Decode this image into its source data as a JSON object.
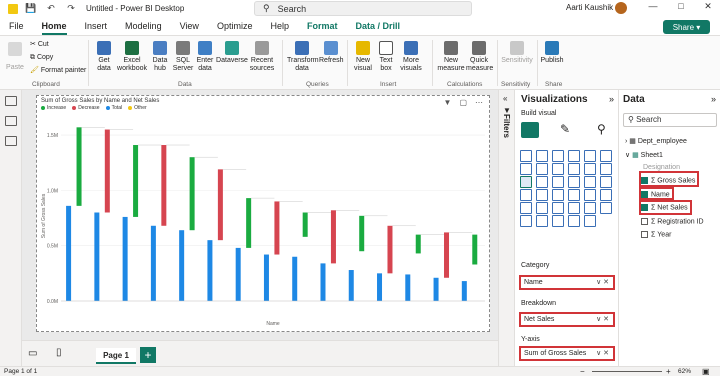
{
  "titlebar": {
    "file_name": "Untitled - Power BI Desktop",
    "search": "Search",
    "user": "Aarti Kaushik"
  },
  "tabs": [
    "File",
    "Home",
    "Insert",
    "Modeling",
    "View",
    "Optimize",
    "Help",
    "Format",
    "Data / Drill"
  ],
  "active_tab": "Home",
  "share_label": "Share",
  "ribbon": {
    "clipboard": {
      "paste": "Paste",
      "cut": "Cut",
      "copy": "Copy",
      "format_painter": "Format painter",
      "group": "Clipboard"
    },
    "data_buttons": [
      {
        "l1": "Get",
        "l2": "data"
      },
      {
        "l1": "Excel",
        "l2": "workbook"
      },
      {
        "l1": "Data",
        "l2": "hub"
      },
      {
        "l1": "SQL",
        "l2": "Server"
      },
      {
        "l1": "Enter",
        "l2": "data"
      },
      {
        "l1": "Dataverse",
        "l2": ""
      },
      {
        "l1": "Recent",
        "l2": "sources"
      }
    ],
    "data_group": "Data",
    "queries": [
      {
        "l1": "Transform",
        "l2": "data"
      },
      {
        "l1": "Refresh",
        "l2": ""
      }
    ],
    "queries_group": "Queries",
    "insert": [
      {
        "l1": "New",
        "l2": "visual"
      },
      {
        "l1": "Text",
        "l2": "box"
      },
      {
        "l1": "More",
        "l2": "visuals"
      }
    ],
    "insert_group": "Insert",
    "calc": [
      {
        "l1": "New",
        "l2": "measure"
      },
      {
        "l1": "Quick",
        "l2": "measure"
      }
    ],
    "calc_group": "Calculations",
    "sensitivity": {
      "l1": "Sensitivity",
      "l2": ""
    },
    "sensitivity_group": "Sensitivity",
    "publish": {
      "l1": "Publish",
      "l2": ""
    },
    "share_group": "Share"
  },
  "visual": {
    "title": "Sum of Gross Sales by Name and Net Sales",
    "legend": [
      {
        "label": "Increase",
        "color": "#1aab40"
      },
      {
        "label": "Decrease",
        "color": "#d64550"
      },
      {
        "label": "Total",
        "color": "#1e88e5"
      },
      {
        "label": "Other",
        "color": "#f2c811"
      }
    ],
    "ylabel": "Sum of Gross Sales",
    "xlabel": "Name",
    "yticks": [
      "1.5M",
      "1.0M",
      "0.5M",
      "0.0M"
    ]
  },
  "chart_data": {
    "type": "bar",
    "subtype": "waterfall",
    "title": "Sum of Gross Sales by Name and Net Sales",
    "ylabel": "Sum of Gross Sales",
    "xlabel": "Name",
    "ylim": [
      0,
      1.6
    ],
    "units": "M",
    "columns": [
      {
        "total": 0.86,
        "bottom": 0.86,
        "top": 1.57,
        "delta": "Increase"
      },
      {
        "total": 0.8,
        "bottom": 0.8,
        "top": 1.55,
        "delta": "Decrease"
      },
      {
        "total": 0.76,
        "bottom": 0.76,
        "top": 1.41,
        "delta": "Increase"
      },
      {
        "total": 0.68,
        "bottom": 0.68,
        "top": 1.41,
        "delta": "Decrease"
      },
      {
        "total": 0.64,
        "bottom": 0.64,
        "top": 1.3,
        "delta": "Increase"
      },
      {
        "total": 0.55,
        "bottom": 0.55,
        "top": 1.19,
        "delta": "Decrease"
      },
      {
        "total": 0.48,
        "bottom": 0.48,
        "top": 0.93,
        "delta": "Increase"
      },
      {
        "total": 0.42,
        "bottom": 0.42,
        "top": 0.9,
        "delta": "Decrease"
      },
      {
        "total": 0.4,
        "bottom": 0.58,
        "top": 0.8,
        "delta": "Increase"
      },
      {
        "total": 0.34,
        "bottom": 0.34,
        "top": 0.82,
        "delta": "Decrease"
      },
      {
        "total": 0.28,
        "bottom": 0.45,
        "top": 0.77,
        "delta": "Increase"
      },
      {
        "total": 0.25,
        "bottom": 0.25,
        "top": 0.68,
        "delta": "Decrease"
      },
      {
        "total": 0.24,
        "bottom": 0.43,
        "top": 0.6,
        "delta": "Increase"
      },
      {
        "total": 0.21,
        "bottom": 0.21,
        "top": 0.62,
        "delta": "Decrease"
      },
      {
        "total": 0.18,
        "bottom": 0.33,
        "top": 0.6,
        "delta": "Increase"
      }
    ]
  },
  "viz_pane": {
    "title": "Visualizations",
    "build_label": "Build visual",
    "category_label": "Category",
    "category_value": "Name",
    "breakdown_label": "Breakdown",
    "breakdown_value": "Net Sales",
    "yaxis_label": "Y-axis",
    "yaxis_value": "Sum of Gross Sales"
  },
  "filters_label": "Filters",
  "data_pane": {
    "title": "Data",
    "search_placeholder": "Search",
    "tables": [
      {
        "name": "Dept_employee"
      },
      {
        "name": "Sheet1"
      }
    ],
    "fields": [
      {
        "name": "Designation",
        "checked": false,
        "sigma": false
      },
      {
        "name": "Gross Sales",
        "checked": true,
        "sigma": true
      },
      {
        "name": "Name",
        "checked": true,
        "sigma": false
      },
      {
        "name": "Net Sales",
        "checked": true,
        "sigma": true
      },
      {
        "name": "Registration ID",
        "checked": false,
        "sigma": true
      },
      {
        "name": "Year",
        "checked": false,
        "sigma": true
      }
    ]
  },
  "page_tab": "Page 1",
  "status": {
    "page": "Page 1 of 1",
    "zoom": "62%"
  }
}
